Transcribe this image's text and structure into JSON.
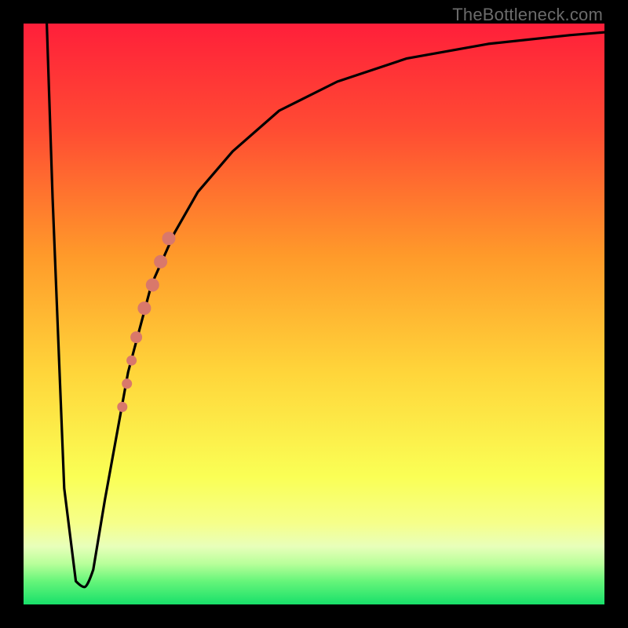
{
  "watermark": "TheBottleneck.com",
  "colors": {
    "top": "#ff1f3a",
    "mid_upper": "#ff8a2a",
    "mid": "#ffd53a",
    "mid_lower": "#faff66",
    "pale_band": "#f5ffb0",
    "lower_green": "#7ef77a",
    "bottom": "#18e06a",
    "curve": "#000000",
    "marker": "#d9786b",
    "frame": "#000000"
  },
  "chart_data": {
    "type": "line",
    "title": "",
    "xlabel": "",
    "ylabel": "",
    "xlim": [
      0,
      100
    ],
    "ylim": [
      0,
      100
    ],
    "grid": false,
    "legend": "none",
    "series": [
      {
        "name": "bottleneck-curve",
        "x": [
          4,
          5,
          7,
          9,
          10,
          11,
          12,
          14,
          18,
          22,
          26,
          30,
          36,
          44,
          54,
          66,
          80,
          94,
          100
        ],
        "y": [
          100,
          70,
          20,
          4,
          3,
          3,
          6,
          18,
          40,
          55,
          64,
          71,
          78,
          85,
          90,
          94,
          96.5,
          98,
          98.5
        ]
      }
    ],
    "markers": {
      "name": "highlight-segment",
      "color": "#d9786b",
      "points": [
        {
          "x": 17.0,
          "y": 34,
          "r": 6
        },
        {
          "x": 17.8,
          "y": 38,
          "r": 6
        },
        {
          "x": 18.6,
          "y": 42,
          "r": 6
        },
        {
          "x": 19.4,
          "y": 46,
          "r": 7
        },
        {
          "x": 20.8,
          "y": 51,
          "r": 8
        },
        {
          "x": 22.2,
          "y": 55,
          "r": 8
        },
        {
          "x": 23.6,
          "y": 59,
          "r": 8
        },
        {
          "x": 25.0,
          "y": 63,
          "r": 8
        }
      ]
    },
    "notes": "Axes are unlabeled in source image; x/y scaled 0–100 as normalized plot-area fractions. Curve descends steeply from top-left into a narrow valley near x≈9–11%, then rises asymptotically toward ~98% at the right edge. A cluster of salmon-colored markers highlights a segment of the rising limb around x≈17–25%."
  }
}
